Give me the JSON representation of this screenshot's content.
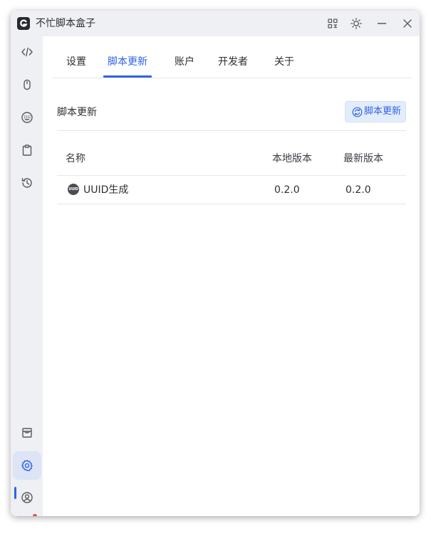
{
  "app": {
    "title": "不忙脚本盒子",
    "logo_icon": "app-logo-icon"
  },
  "titlebar": {
    "icons": [
      "grid-icon",
      "sun-icon",
      "minimize-icon",
      "close-icon"
    ]
  },
  "sidebar": {
    "top_items": [
      {
        "icon": "code-icon"
      },
      {
        "icon": "mouse-icon"
      },
      {
        "icon": "keyboard-icon"
      },
      {
        "icon": "clipboard-icon"
      },
      {
        "icon": "history-icon"
      }
    ],
    "bottom_items": [
      {
        "icon": "store-icon"
      },
      {
        "icon": "settings-icon",
        "active": true
      },
      {
        "icon": "user-icon",
        "has_notification": true
      }
    ]
  },
  "tabs": [
    {
      "label": "设置"
    },
    {
      "label": "脚本更新",
      "active": true
    },
    {
      "label": "账户"
    },
    {
      "label": "开发者"
    },
    {
      "label": "关于"
    }
  ],
  "section": {
    "title": "脚本更新",
    "update_button": "脚本更新"
  },
  "table": {
    "headers": {
      "name": "名称",
      "local_version": "本地版本",
      "latest_version": "最新版本"
    },
    "rows": [
      {
        "icon_text": "UUID",
        "name": "UUID生成",
        "local_version": "0.2.0",
        "latest_version": "0.2.0"
      }
    ]
  },
  "colors": {
    "accent": "#2f62e8",
    "sidebar_bg": "#eef0f3",
    "notification": "#e84848"
  }
}
